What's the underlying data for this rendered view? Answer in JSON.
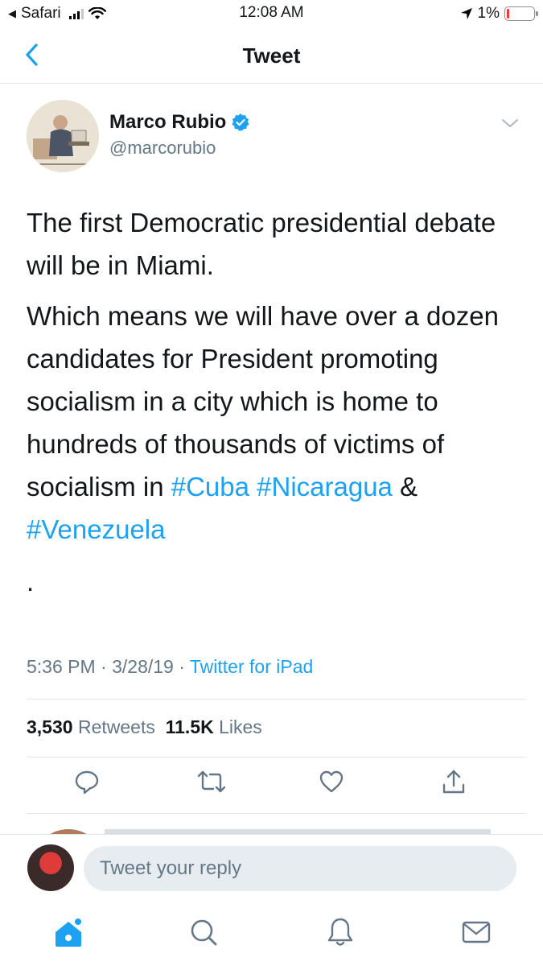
{
  "status_bar": {
    "back_app": "Safari",
    "time": "12:08 AM",
    "battery_text": "1%",
    "battery_level": 0.01
  },
  "nav": {
    "title": "Tweet",
    "back_icon": "chevron-left-icon"
  },
  "tweet": {
    "author_name": "Marco Rubio",
    "author_handle": "@marcorubio",
    "verified": true,
    "paragraph1": "The first Democratic presidential debate will be in Miami.",
    "paragraph2_text": "Which means we will have over a dozen candidates for President promoting socialism in a city which is home to hundreds of thousands of victims of socialism in ",
    "hashtag_cuba": "#Cuba",
    "hashtag_nicaragua": "#Nicaragua",
    "amp": "&",
    "hashtag_venezuela": "#Venezuela",
    "trailing": ".",
    "time": "5:36 PM",
    "date": "3/28/19",
    "separator": "·",
    "source": "Twitter for iPad"
  },
  "stats": {
    "retweets_count": "3,530",
    "retweets_label": "Retweets",
    "likes_count": "11.5K",
    "likes_label": "Likes"
  },
  "actions": [
    "reply-icon",
    "retweet-icon",
    "like-icon",
    "share-icon"
  ],
  "composer": {
    "placeholder": "Tweet your reply"
  },
  "tabbar": [
    "home-icon",
    "search-icon",
    "notifications-icon",
    "messages-icon"
  ],
  "colors": {
    "accent": "#1da1f2",
    "secondary_text": "#657786",
    "primary_text": "#14171a",
    "divider": "#e1e8ed"
  }
}
